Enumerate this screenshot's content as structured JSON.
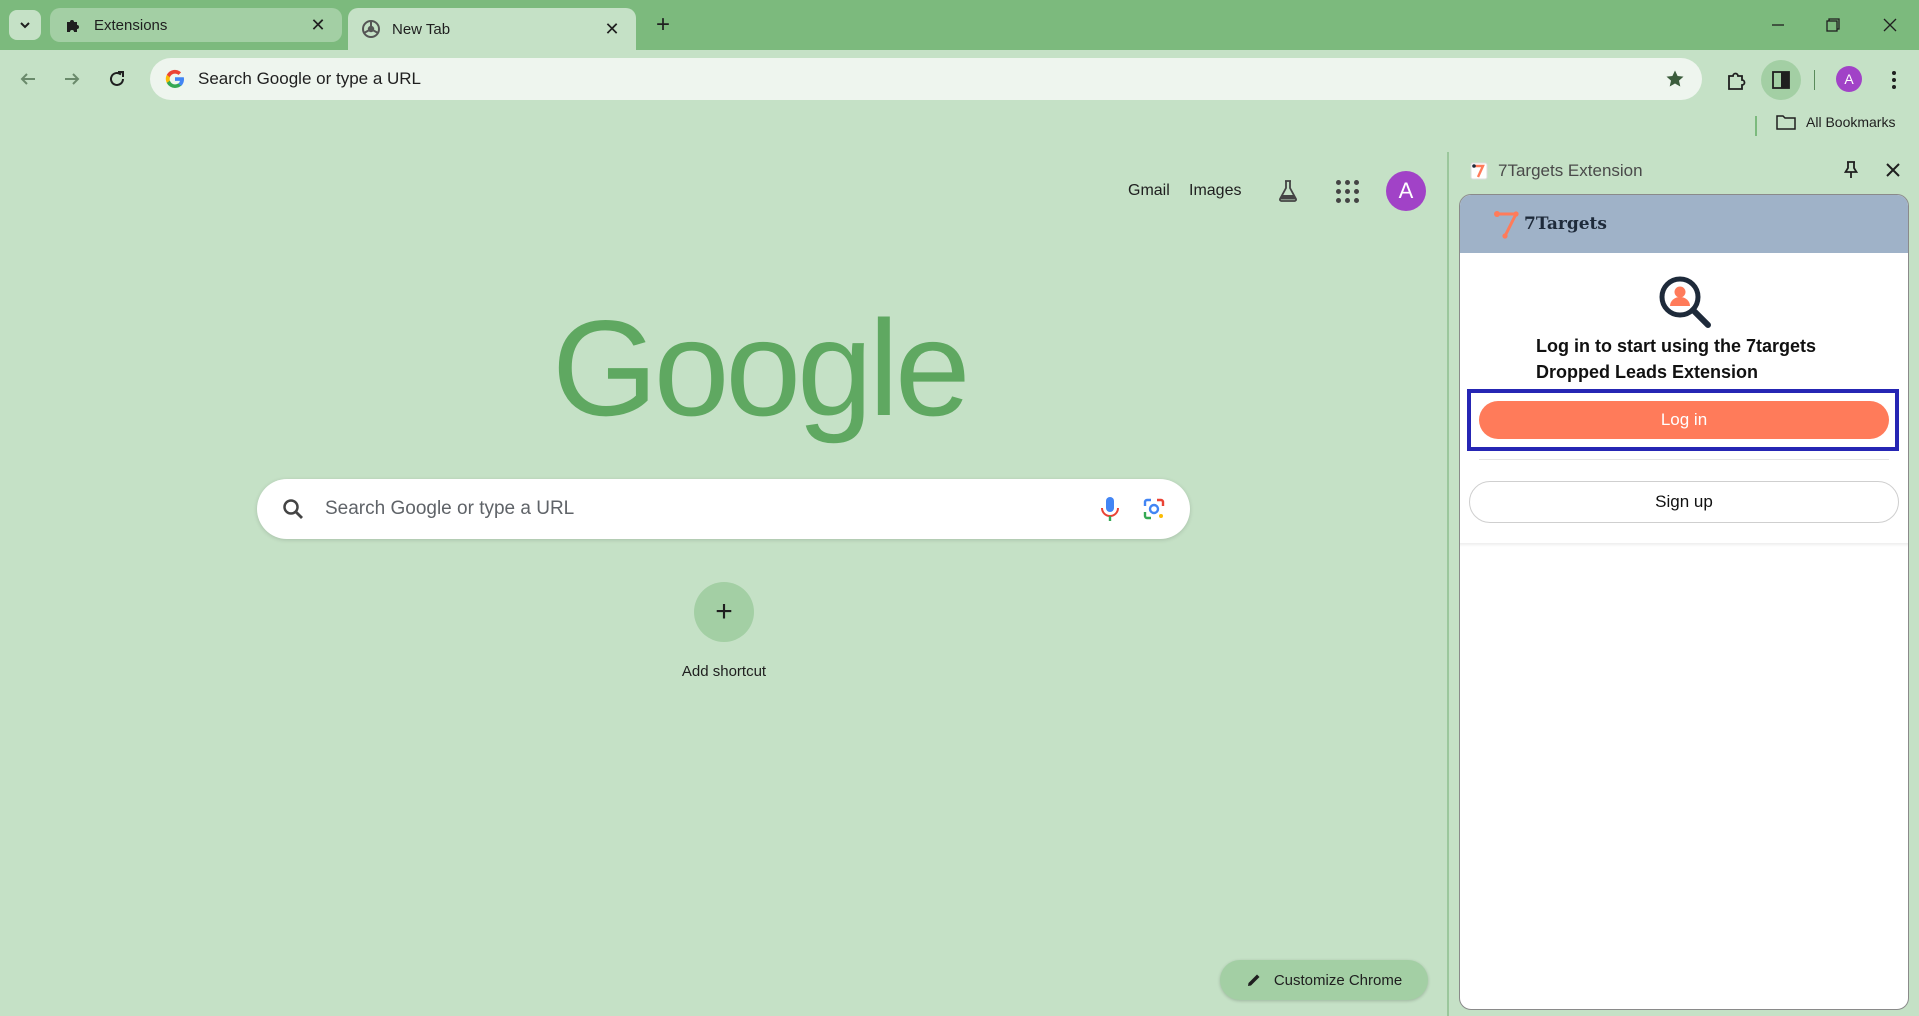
{
  "browser": {
    "tabs": [
      {
        "title": "Extensions",
        "icon": "puzzle-icon",
        "active": false
      },
      {
        "title": "New Tab",
        "icon": "chrome-icon",
        "active": true
      }
    ],
    "new_tab_label": "+",
    "address_bar": {
      "placeholder": "Search Google or type a URL"
    },
    "profile_initial": "A",
    "bookmarks": {
      "all_bookmarks_label": "All Bookmarks"
    },
    "theme_colors": {
      "frame": "#7cba7d",
      "background": "#c5e1c6",
      "accent": "#a142c7"
    }
  },
  "ntp": {
    "links": {
      "gmail": "Gmail",
      "images": "Images"
    },
    "avatar_initial": "A",
    "logo_text": "Google",
    "search_placeholder": "Search Google or type a URL",
    "add_shortcut_label": "Add shortcut",
    "customize_label": "Customize Chrome"
  },
  "side_panel": {
    "title": "7Targets Extension",
    "extension": {
      "brand": "7Targets",
      "heading": "Log in to start using the 7targets Dropped Leads Extension",
      "login_label": "Log in",
      "signup_label": "Sign up",
      "brand_color": "#ff7b5a",
      "header_color": "#9fb2c8"
    }
  }
}
